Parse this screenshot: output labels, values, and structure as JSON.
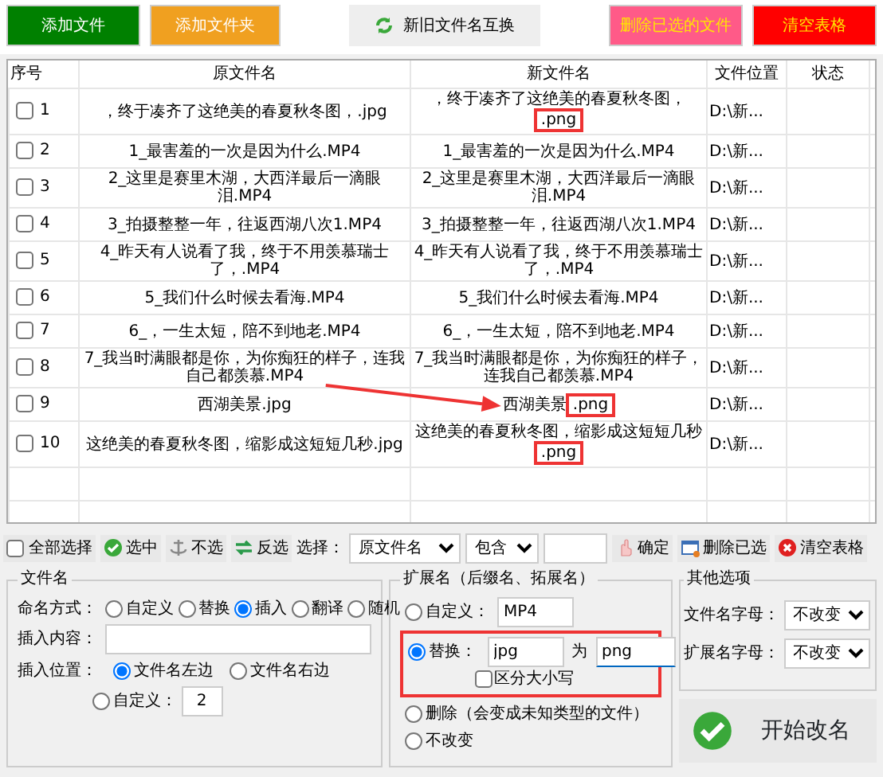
{
  "toolbar": [
    {
      "label": "添加文件",
      "kind": "green"
    },
    {
      "label": "添加文件夹",
      "kind": "orange"
    },
    {
      "label": "新旧文件名互换",
      "kind": "swap"
    },
    {
      "label": "删除已选的文件",
      "kind": "pink"
    },
    {
      "label": "清空表格",
      "kind": "red"
    }
  ],
  "table": {
    "columns": [
      "序号",
      "原文件名",
      "新文件名",
      "文件位置",
      "状态"
    ],
    "rows": [
      {
        "no": "1",
        "checked": false,
        "original": "，终于凑齐了这绝美的春夏秋冬图，.jpg",
        "new_name": "，终于凑齐了这绝美的春夏秋冬图，",
        "marked_ext": ".png",
        "location": "D:\\新..."
      },
      {
        "no": "2",
        "checked": false,
        "original": "1_最害羞的一次是因为什么.MP4",
        "new_name": "1_最害羞的一次是因为什么.MP4",
        "location": "D:\\新..."
      },
      {
        "no": "3",
        "checked": false,
        "original": "2_这里是赛里木湖，大西洋最后一滴眼泪.MP4",
        "new_name": "2_这里是赛里木湖，大西洋最后一滴眼泪.MP4",
        "location": "D:\\新..."
      },
      {
        "no": "4",
        "checked": false,
        "original": "3_拍摄整整一年，往返西湖八次1.MP4",
        "new_name": "3_拍摄整整一年，往返西湖八次1.MP4",
        "location": "D:\\新..."
      },
      {
        "no": "5",
        "checked": false,
        "original": "4_昨天有人说看了我，终于不用羡慕瑞士了，.MP4",
        "new_name": "4_昨天有人说看了我，终于不用羡慕瑞士了，.MP4",
        "location": "D:\\新..."
      },
      {
        "no": "6",
        "checked": false,
        "original": "5_我们什么时候去看海.MP4",
        "new_name": "5_我们什么时候去看海.MP4",
        "location": "D:\\新..."
      },
      {
        "no": "7",
        "checked": false,
        "original": "6_，一生太短，陪不到地老.MP4",
        "new_name": "6_，一生太短，陪不到地老.MP4",
        "location": "D:\\新..."
      },
      {
        "no": "8",
        "checked": false,
        "original": "7_我当时满眼都是你，为你痴狂的样子，连我自己都羡慕.MP4",
        "new_name": "7_我当时满眼都是你，为你痴狂的样子，连我自己都羡慕.MP4",
        "location": "D:\\新..."
      },
      {
        "no": "9",
        "checked": false,
        "original": "西湖美景.jpg",
        "new_name": "西湖美景",
        "marked_ext": ".png",
        "arrow_target": true,
        "location": "D:\\新..."
      },
      {
        "no": "10",
        "checked": false,
        "original": "这绝美的春夏秋冬图，缩影成这短短几秒.jpg",
        "new_name": "这绝美的春夏秋冬图，缩影成这短短几秒",
        "marked_ext": ".png",
        "location": "D:\\新..."
      }
    ]
  },
  "select_bar": {
    "select_all": {
      "label": "全部选择",
      "checked": false
    },
    "actions": [
      {
        "label": "选中",
        "kind": "check"
      },
      {
        "label": "不选",
        "kind": "anchor"
      },
      {
        "label": "反选",
        "kind": "swap"
      }
    ],
    "select_label": "选择：",
    "field": "原文件名",
    "match": "包含",
    "confirm": "确定",
    "delete_selected": "删除已选",
    "clear": "清空表格"
  },
  "filename_panel": {
    "title": "文件名",
    "mode_label": "命名方式：",
    "modes": [
      {
        "label": "自定义",
        "selected": false
      },
      {
        "label": "替换",
        "selected": false
      },
      {
        "label": "插入",
        "selected": true
      },
      {
        "label": "翻译",
        "selected": false
      },
      {
        "label": "随机",
        "selected": false
      }
    ],
    "insert_label": "插入内容：",
    "position_label": "插入位置：",
    "positions": [
      {
        "label": "文件名左边",
        "selected": true
      },
      {
        "label": "文件名右边",
        "selected": false
      }
    ],
    "custom": {
      "label": "自定义：",
      "selected": false,
      "value": "2"
    }
  },
  "ext_panel": {
    "title": "扩展名（后缀名、拓展名）",
    "custom": {
      "label": "自定义：",
      "selected": false,
      "value": "MP4"
    },
    "replace": {
      "label": "替换：",
      "selected": true,
      "highlighted": true,
      "from": "jpg",
      "to_label": "为",
      "to": "png"
    },
    "case_sensitive": {
      "label": "区分大小写",
      "checked": false
    },
    "delete": {
      "label": "删除（会变成未知类型的文件）",
      "selected": false
    },
    "keep": {
      "label": "不改变",
      "selected": false
    }
  },
  "other_panel": {
    "title": "其他选项",
    "name_case_label": "文件名字母：",
    "name_case": "不改变",
    "ext_case_label": "扩展名字母：",
    "ext_case": "不改变"
  },
  "start_button": "开始改名"
}
